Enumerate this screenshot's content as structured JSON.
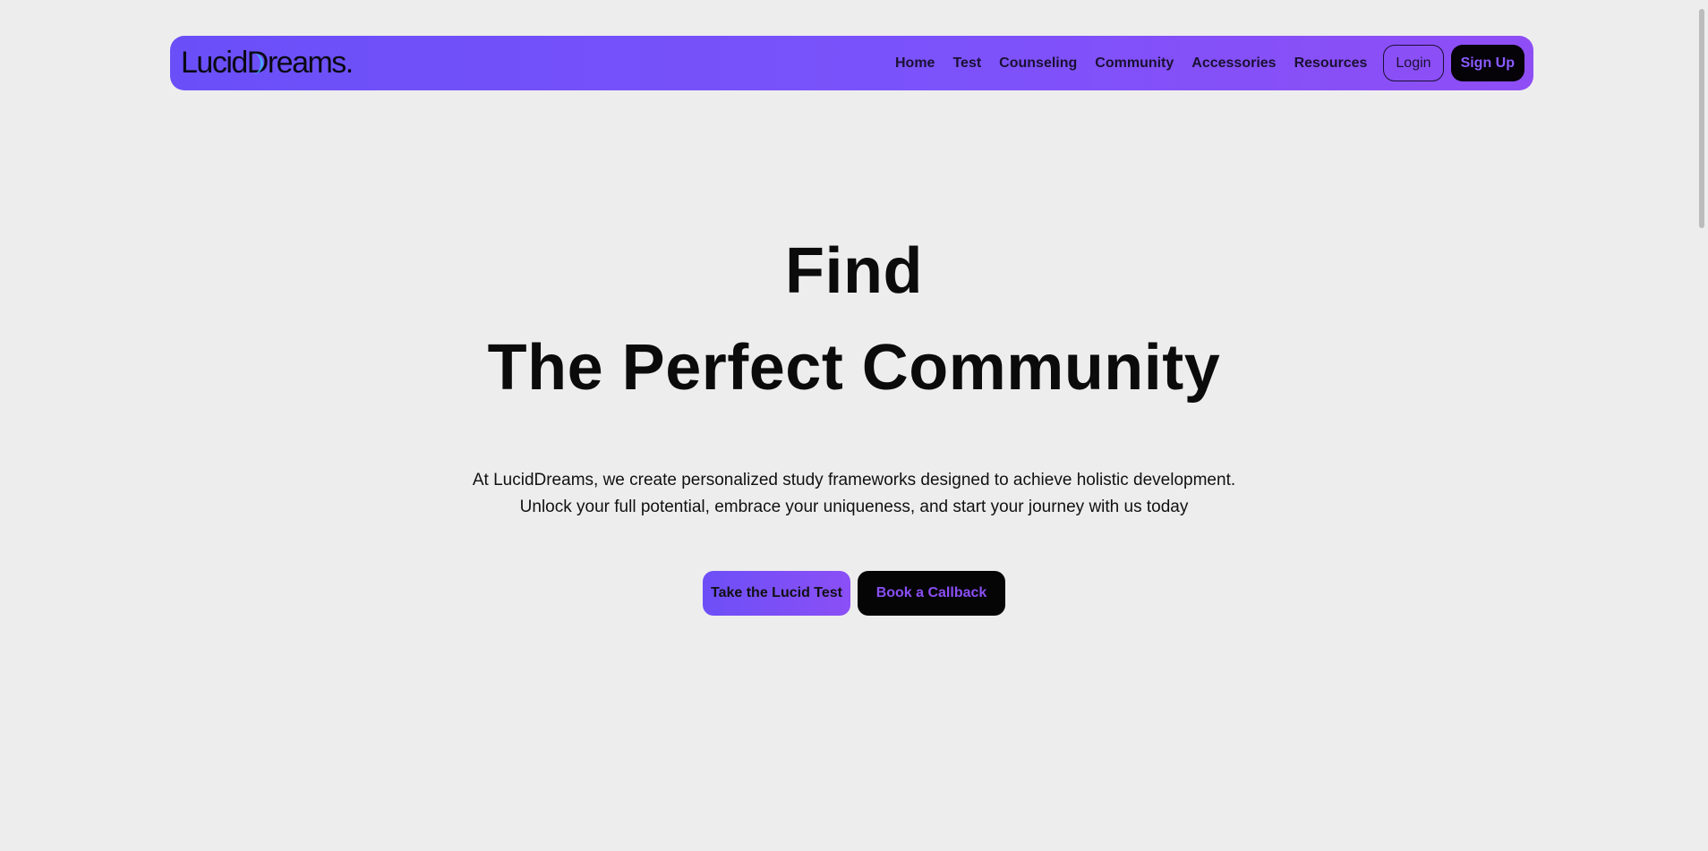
{
  "navbar": {
    "logo_text_before": "Lucid",
    "logo_mark": "D",
    "logo_text_after": "reams.",
    "links": [
      {
        "label": "Home"
      },
      {
        "label": "Test"
      },
      {
        "label": "Counseling"
      },
      {
        "label": "Community"
      },
      {
        "label": "Accessories"
      },
      {
        "label": "Resources"
      }
    ],
    "login_label": "Login",
    "signup_label": "Sign Up"
  },
  "hero": {
    "line1": "Find",
    "line2": "The Perfect Community",
    "desc_line1": "At LucidDreams, we create personalized study frameworks designed to achieve holistic development.",
    "desc_line2": "Unlock your full potential, embrace your uniqueness, and start your journey with us today",
    "cta_primary": "Take the Lucid Test",
    "cta_secondary": "Book a Callback"
  },
  "colors": {
    "brand_purple": "#7b52fb",
    "page_background": "#eeedee",
    "dark": "#050505"
  }
}
